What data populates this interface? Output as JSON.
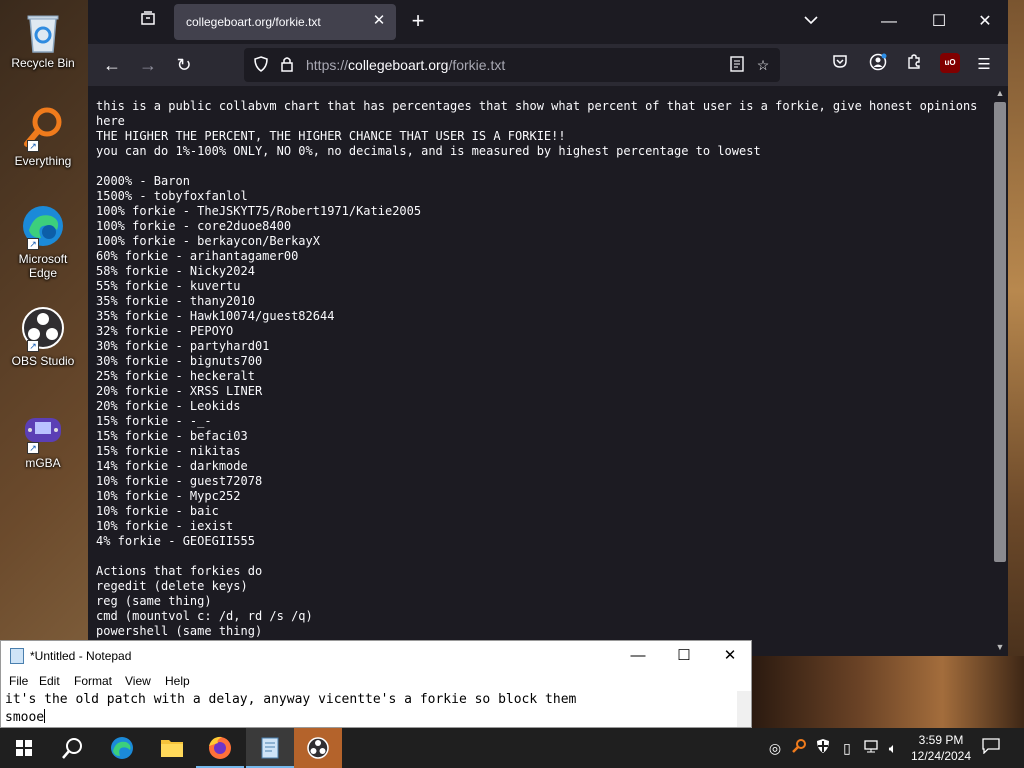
{
  "desktop": {
    "icons": [
      {
        "label": "Recycle Bin",
        "icon": "recycle-bin-icon"
      },
      {
        "label": "Everything",
        "icon": "search-magnifier-icon"
      },
      {
        "label": "Microsoft Edge",
        "icon": "edge-icon"
      },
      {
        "label": "OBS Studio",
        "icon": "obs-icon"
      },
      {
        "label": "mGBA",
        "icon": "gameboy-icon"
      }
    ]
  },
  "browser": {
    "tab_title": "collegeboart.org/forkie.txt",
    "url_prefix": "https://",
    "url_domain": "collegeboart.org",
    "url_path": "/forkie.txt",
    "page_lines": [
      "this is a public collabvm chart that has percentages that show what percent of that user is a forkie, give honest opinions",
      "here",
      "THE HIGHER THE PERCENT, THE HIGHER CHANCE THAT USER IS A FORKIE!!",
      "you can do 1%-100% ONLY, NO 0%, no decimals, and is measured by highest percentage to lowest",
      "",
      "2000% - Baron",
      "1500% - tobyfoxfanlol",
      "100% forkie - TheJSKYT75/Robert1971/Katie2005",
      "100% forkie - core2duoe8400",
      "100% forkie - berkaycon/BerkayX",
      "60% forkie - arihantagamer00",
      "58% forkie - Nicky2024",
      "55% forkie - kuvertu",
      "35% forkie - thany2010",
      "35% forkie - Hawk10074/guest82644",
      "32% forkie - PEPOYO",
      "30% forkie - partyhard01",
      "30% forkie - bignuts700",
      "25% forkie - heckeralt",
      "20% forkie - XRSS LINER",
      "20% forkie - Leokids",
      "15% forkie - -_-",
      "15% forkie - befaci03",
      "15% forkie - nikitas",
      "14% forkie - darkmode",
      "10% forkie - guest72078",
      "10% forkie - Mypc252",
      "10% forkie - baic",
      "10% forkie - iexist",
      "4% forkie - GEOEGII555",
      "",
      "Actions that forkies do",
      "regedit (delete keys)",
      "reg (same thing)",
      "cmd (mountvol c: /d, rd /s /q)",
      "powershell (same thing)"
    ]
  },
  "notepad": {
    "title": "*Untitled - Notepad",
    "menu": [
      "File",
      "Edit",
      "Format",
      "View",
      "Help"
    ],
    "line1": "it's the old patch with a delay, anyway vicentte's a forkie so block them",
    "line2": "smooe"
  },
  "taskbar": {
    "time": "3:59 PM",
    "date": "12/24/2024"
  },
  "colors": {
    "browser_bg": "#1c1b22",
    "toolbar": "#2b2a33",
    "tab_active": "#42414d",
    "taskbar": "#1f1f1f",
    "accent": "#76b9ed"
  }
}
